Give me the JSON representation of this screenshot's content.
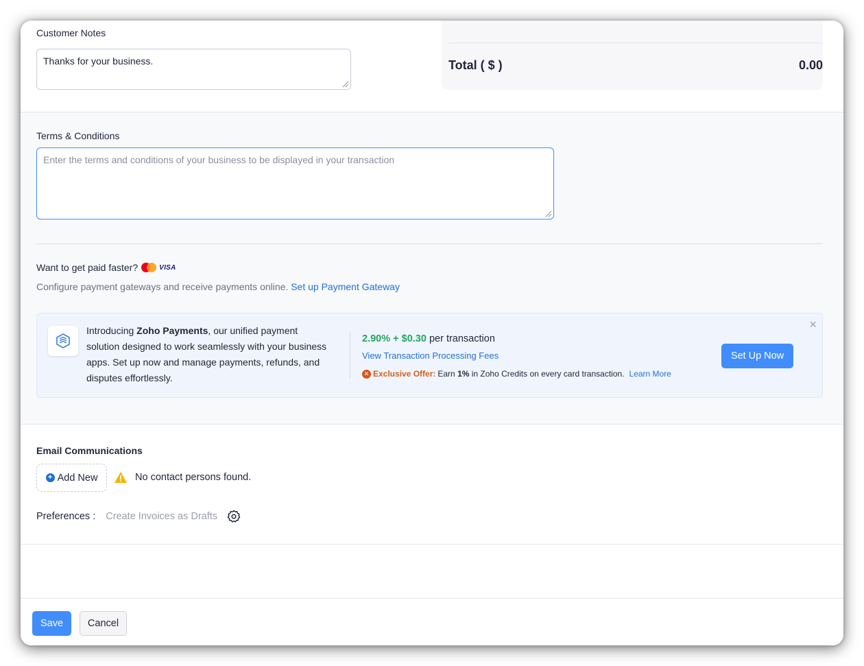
{
  "notes": {
    "label": "Customer Notes",
    "value": "Thanks for your business."
  },
  "total": {
    "label": "Total ( $ )",
    "value": "0.00"
  },
  "terms": {
    "label": "Terms & Conditions",
    "placeholder": "Enter the terms and conditions of your business to be displayed in your transaction"
  },
  "payment": {
    "headline": "Want to get paid faster?",
    "visa_text": "VISA",
    "config_text": "Configure payment gateways and receive payments online. ",
    "setup_link": "Set up Payment Gateway"
  },
  "promo": {
    "intro": "Introducing ",
    "brand": "Zoho Payments",
    "rest": ", our unified payment solution designed to work seamlessly with your business apps. Set up now and manage payments, refunds, and disputes effortlessly.",
    "rate": "2.90% + $0.30",
    "rate_suffix": " per transaction",
    "fees_link": "View Transaction Processing Fees",
    "offer_tag": "Exclusive Offer:",
    "offer_pre": "Earn ",
    "offer_bold": "1%",
    "offer_post": " in Zoho Credits on every card transaction.",
    "learn_more": "Learn More",
    "button": "Set Up Now",
    "close": "×"
  },
  "email": {
    "label": "Email Communications",
    "add_new": "Add New",
    "warning": "No contact persons found."
  },
  "preferences": {
    "label": "Preferences :",
    "value": "Create Invoices as Drafts"
  },
  "footer": {
    "save": "Save",
    "cancel": "Cancel"
  },
  "colors": {
    "primary": "#408dfb",
    "link": "#1f6fd6",
    "rate_green": "#24a65a",
    "offer_orange": "#d0601d"
  }
}
